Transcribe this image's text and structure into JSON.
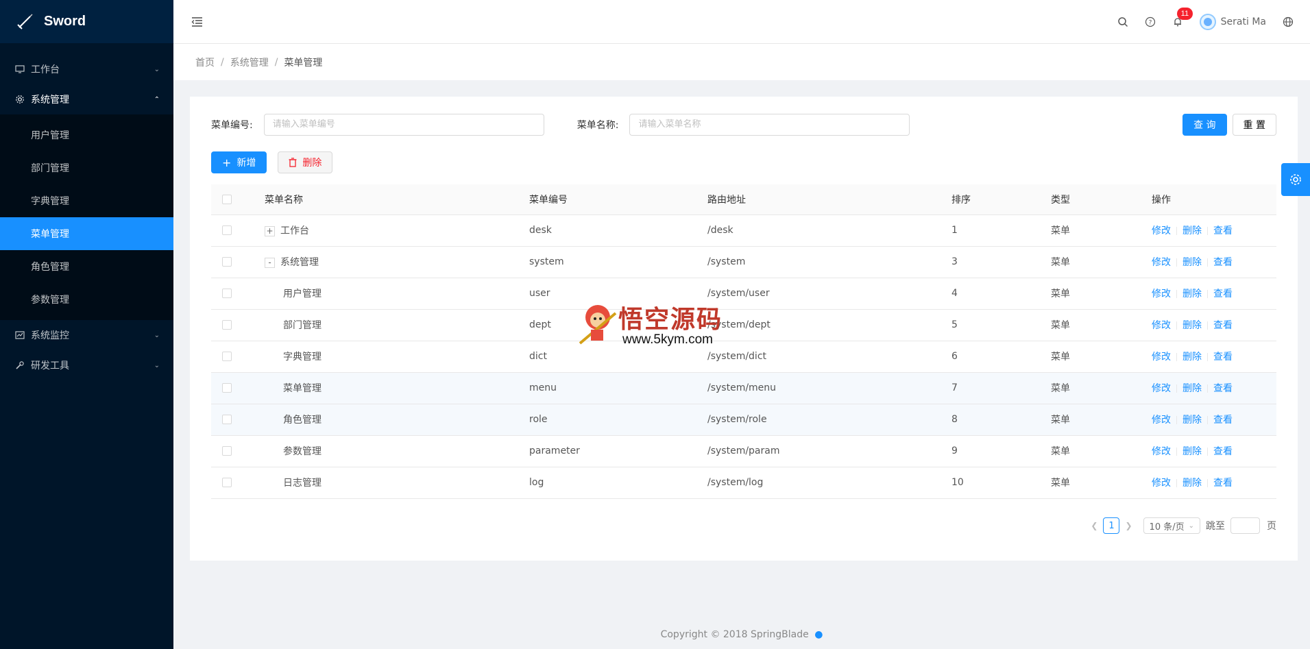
{
  "app": {
    "name": "Sword"
  },
  "sidebar": {
    "items": [
      {
        "label": "工作台",
        "icon": "monitor-icon"
      },
      {
        "label": "系统管理",
        "icon": "gear-icon",
        "open": true
      },
      {
        "label": "系统监控",
        "icon": "chart-icon"
      },
      {
        "label": "研发工具",
        "icon": "wrench-icon"
      }
    ],
    "submenu": [
      {
        "label": "用户管理"
      },
      {
        "label": "部门管理"
      },
      {
        "label": "字典管理"
      },
      {
        "label": "菜单管理",
        "active": true
      },
      {
        "label": "角色管理"
      },
      {
        "label": "参数管理"
      }
    ]
  },
  "header": {
    "notification_count": "11",
    "user_name": "Serati Ma"
  },
  "breadcrumb": {
    "home": "首页",
    "parent": "系统管理",
    "current": "菜单管理"
  },
  "search": {
    "code_label": "菜单编号:",
    "code_placeholder": "请输入菜单编号",
    "name_label": "菜单名称:",
    "name_placeholder": "请输入菜单名称",
    "query_label": "查 询",
    "reset_label": "重 置"
  },
  "actions": {
    "add_label": "新增",
    "delete_label": "删除"
  },
  "table": {
    "headers": {
      "name": "菜单名称",
      "code": "菜单编号",
      "path": "路由地址",
      "sort": "排序",
      "type": "类型",
      "ops": "操作"
    },
    "rows": [
      {
        "name": "工作台",
        "code": "desk",
        "path": "/desk",
        "sort": "1",
        "type": "菜单",
        "expander": "+"
      },
      {
        "name": "系统管理",
        "code": "system",
        "path": "/system",
        "sort": "3",
        "type": "菜单",
        "expander": "-"
      },
      {
        "name": "用户管理",
        "code": "user",
        "path": "/system/user",
        "sort": "4",
        "type": "菜单"
      },
      {
        "name": "部门管理",
        "code": "dept",
        "path": "/system/dept",
        "sort": "5",
        "type": "菜单"
      },
      {
        "name": "字典管理",
        "code": "dict",
        "path": "/system/dict",
        "sort": "6",
        "type": "菜单"
      },
      {
        "name": "菜单管理",
        "code": "menu",
        "path": "/system/menu",
        "sort": "7",
        "type": "菜单"
      },
      {
        "name": "角色管理",
        "code": "role",
        "path": "/system/role",
        "sort": "8",
        "type": "菜单"
      },
      {
        "name": "参数管理",
        "code": "parameter",
        "path": "/system/param",
        "sort": "9",
        "type": "菜单"
      },
      {
        "name": "日志管理",
        "code": "log",
        "path": "/system/log",
        "sort": "10",
        "type": "菜单"
      }
    ],
    "op_edit": "修改",
    "op_delete": "删除",
    "op_view": "查看"
  },
  "pagination": {
    "current_page": "1",
    "page_size": "10 条/页",
    "jump_label": "跳至",
    "page_suffix": "页"
  },
  "footer": {
    "copyright": "Copyright © 2018 SpringBlade"
  },
  "watermark": {
    "title": "悟空源码",
    "url": "www.5kym.com"
  },
  "colors": {
    "primary": "#1890ff",
    "sidebar_bg": "#001529",
    "danger": "#f5222d"
  }
}
